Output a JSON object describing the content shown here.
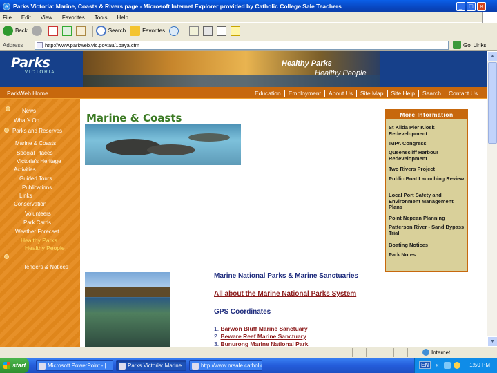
{
  "window": {
    "title": "Parks Victoria: Marine, Coasts & Rivers page - Microsoft Internet Explorer provided by Catholic College Sale Teachers",
    "controls": [
      "_",
      "□",
      "×"
    ]
  },
  "menu": [
    "File",
    "Edit",
    "View",
    "Favorites",
    "Tools",
    "Help"
  ],
  "toolbar": {
    "back": "Back",
    "search": "Search",
    "favorites": "Favorites"
  },
  "address": {
    "label": "Address",
    "url": "http://www.parkweb.vic.gov.au/1baya.cfm",
    "go": "Go",
    "links": "Links"
  },
  "site": {
    "logo": "Parks",
    "logo_sub": "VICTORIA",
    "tagline1": "Healthy Parks",
    "tagline2": "Healthy People",
    "nav_home": "ParkWeb Home",
    "nav_links": [
      "Education",
      "Employment",
      "About Us",
      "Site Map",
      "Site Help",
      "Search",
      "Contact Us"
    ]
  },
  "sidebar": {
    "items": [
      "News",
      "What's On",
      "Parks and Reserves",
      "Marine & Coasts",
      "Special Places",
      "Victoria's Heritage",
      "Activities",
      "Guided Tours",
      "Publications",
      "Links",
      "Conservation",
      "Volunteers",
      "Park Cards",
      "Weather Forecast"
    ],
    "healthy1": "Healthy Parks",
    "healthy2": "Healthy People",
    "tenders": "Tenders & Notices"
  },
  "main": {
    "title": "Marine & Coasts",
    "mnp_heading": "Marine National Parks & Marine Sanctuaries",
    "mnp_link": "All about the Marine National Parks System",
    "gps_heading": "GPS Coordinates",
    "gps_list": [
      {
        "num": "1.",
        "name": "Barwon Bluff Marine Sanctuary"
      },
      {
        "num": "2.",
        "name": "Beware Reef Marine Sanctuary"
      },
      {
        "num": "3.",
        "name": "Bunurong Marine National Park"
      }
    ]
  },
  "more_info": {
    "header": "More Information",
    "items": [
      "St Kilda Pier Kiosk Redevelopment",
      "IMPA Congress",
      "Queenscliff Harbour Redevelopment",
      "Two Rivers Project",
      "Public Boat Launching Review",
      "Local Port Safety and Environment Management Plans",
      "Point Nepean Planning",
      "Patterson River - Sand Bypass Trial",
      "Boating Notices",
      "Park Notes"
    ]
  },
  "status": {
    "zone": "Internet"
  },
  "taskbar": {
    "start": "start",
    "tasks": [
      "Microsoft PowerPoint - [...",
      "Parks Victoria: Marine...",
      "http://www.nrsale.catholic..."
    ],
    "lang": "EN",
    "clock": "1:50 PM"
  }
}
